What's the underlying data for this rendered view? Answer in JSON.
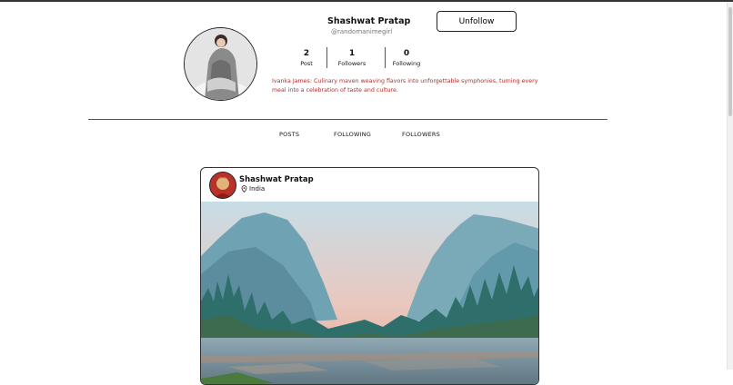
{
  "profile": {
    "name": "Shashwat Pratap",
    "handle": "@randomanimegirl",
    "unfollow_label": "Unfollow",
    "bio": "Ivanka James: Culinary maven weaving flavors into unforgettable symphonies, turning every meal into a celebration of taste and culture."
  },
  "stats": [
    {
      "value": "2",
      "label": "Post"
    },
    {
      "value": "1",
      "label": "Followers"
    },
    {
      "value": "0",
      "label": "Following"
    }
  ],
  "tabs": [
    {
      "label": "POSTS"
    },
    {
      "label": "FOLLOWING"
    },
    {
      "label": "FOLLOWERS"
    }
  ],
  "post": {
    "user": "Shashwat Pratap",
    "location": "India",
    "location_icon": "map-pin-icon"
  }
}
